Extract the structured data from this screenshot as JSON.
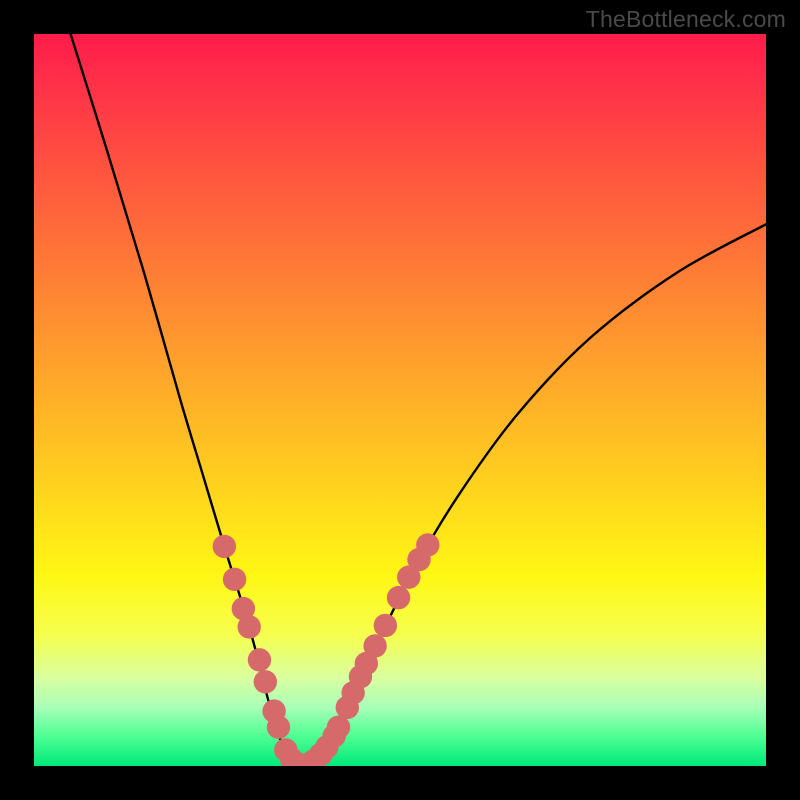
{
  "watermark": "TheBottleneck.com",
  "chart_data": {
    "type": "line",
    "title": "",
    "xlabel": "",
    "ylabel": "",
    "xlim": [
      0,
      100
    ],
    "ylim": [
      0,
      100
    ],
    "series": [
      {
        "name": "bottleneck-curve",
        "x": [
          5,
          10,
          15,
          20,
          23,
          26,
          28.5,
          30.5,
          32,
          33.5,
          35,
          37,
          39,
          41,
          43.5,
          47,
          52,
          58,
          66,
          76,
          88,
          100
        ],
        "values": [
          100,
          84,
          67.5,
          50,
          40,
          30,
          22,
          15,
          9,
          4,
          1,
          0,
          1,
          4,
          9.5,
          17,
          27,
          37,
          48,
          58.5,
          67.5,
          74
        ]
      }
    ],
    "markers": {
      "name": "highlight-dots",
      "color_hex": "#d66a6a",
      "radius_frac": 0.016,
      "points": [
        {
          "x": 26.0,
          "y": 30.0
        },
        {
          "x": 27.4,
          "y": 25.5
        },
        {
          "x": 28.6,
          "y": 21.5
        },
        {
          "x": 29.4,
          "y": 19.0
        },
        {
          "x": 30.8,
          "y": 14.5
        },
        {
          "x": 31.6,
          "y": 11.5
        },
        {
          "x": 32.8,
          "y": 7.5
        },
        {
          "x": 33.4,
          "y": 5.3
        },
        {
          "x": 34.4,
          "y": 2.2
        },
        {
          "x": 35.2,
          "y": 0.9
        },
        {
          "x": 36.2,
          "y": 0.2
        },
        {
          "x": 37.4,
          "y": 0.2
        },
        {
          "x": 38.2,
          "y": 0.7
        },
        {
          "x": 39.2,
          "y": 1.6
        },
        {
          "x": 40.0,
          "y": 2.6
        },
        {
          "x": 41.0,
          "y": 4.1
        },
        {
          "x": 41.6,
          "y": 5.3
        },
        {
          "x": 42.8,
          "y": 8.0
        },
        {
          "x": 43.6,
          "y": 10.0
        },
        {
          "x": 44.6,
          "y": 12.2
        },
        {
          "x": 45.4,
          "y": 14.0
        },
        {
          "x": 46.6,
          "y": 16.4
        },
        {
          "x": 48.0,
          "y": 19.2
        },
        {
          "x": 49.8,
          "y": 23.0
        },
        {
          "x": 51.2,
          "y": 25.8
        },
        {
          "x": 52.6,
          "y": 28.2
        },
        {
          "x": 53.8,
          "y": 30.2
        }
      ]
    },
    "gradient_stops": [
      {
        "pos": 0.0,
        "hex": "#ff1c4a"
      },
      {
        "pos": 0.18,
        "hex": "#ff5240"
      },
      {
        "pos": 0.46,
        "hex": "#ffa42b"
      },
      {
        "pos": 0.74,
        "hex": "#fff714"
      },
      {
        "pos": 0.92,
        "hex": "#a8ffb8"
      },
      {
        "pos": 1.0,
        "hex": "#00e878"
      }
    ]
  }
}
